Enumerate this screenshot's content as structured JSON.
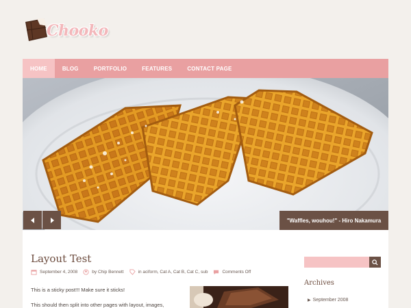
{
  "site": {
    "logo_text": "Chooko"
  },
  "nav": {
    "items": [
      {
        "label": "HOME",
        "active": true
      },
      {
        "label": "BLOG",
        "active": false
      },
      {
        "label": "PORTFOLIO",
        "active": false
      },
      {
        "label": "FEATURES",
        "active": false
      },
      {
        "label": "CONTACT PAGE",
        "active": false
      }
    ]
  },
  "slider": {
    "caption": "\"Waffles, wouhou!\" - Hiro Nakamura",
    "prev_icon": "chevron-left-icon",
    "next_icon": "chevron-right-icon"
  },
  "post": {
    "title": "Layout Test",
    "date": "September 4, 2008",
    "author": "by Chip Bennett",
    "categories": "in aciform, Cat A, Cat B, Cat C, sub",
    "comments": "Comments Off",
    "text1": "This is a sticky post!!! Make sure it sticks!",
    "text2": "This should then split into other pages with layout, images,"
  },
  "sidebar": {
    "search_placeholder": "",
    "search_icon": "search-icon",
    "archives_title": "Archives",
    "archives": [
      "September 2008"
    ]
  },
  "colors": {
    "nav_bg": "#e9a0a1",
    "nav_active": "#f6c3c4",
    "brown": "#6b5145",
    "page_bg": "#f3f0ec"
  }
}
